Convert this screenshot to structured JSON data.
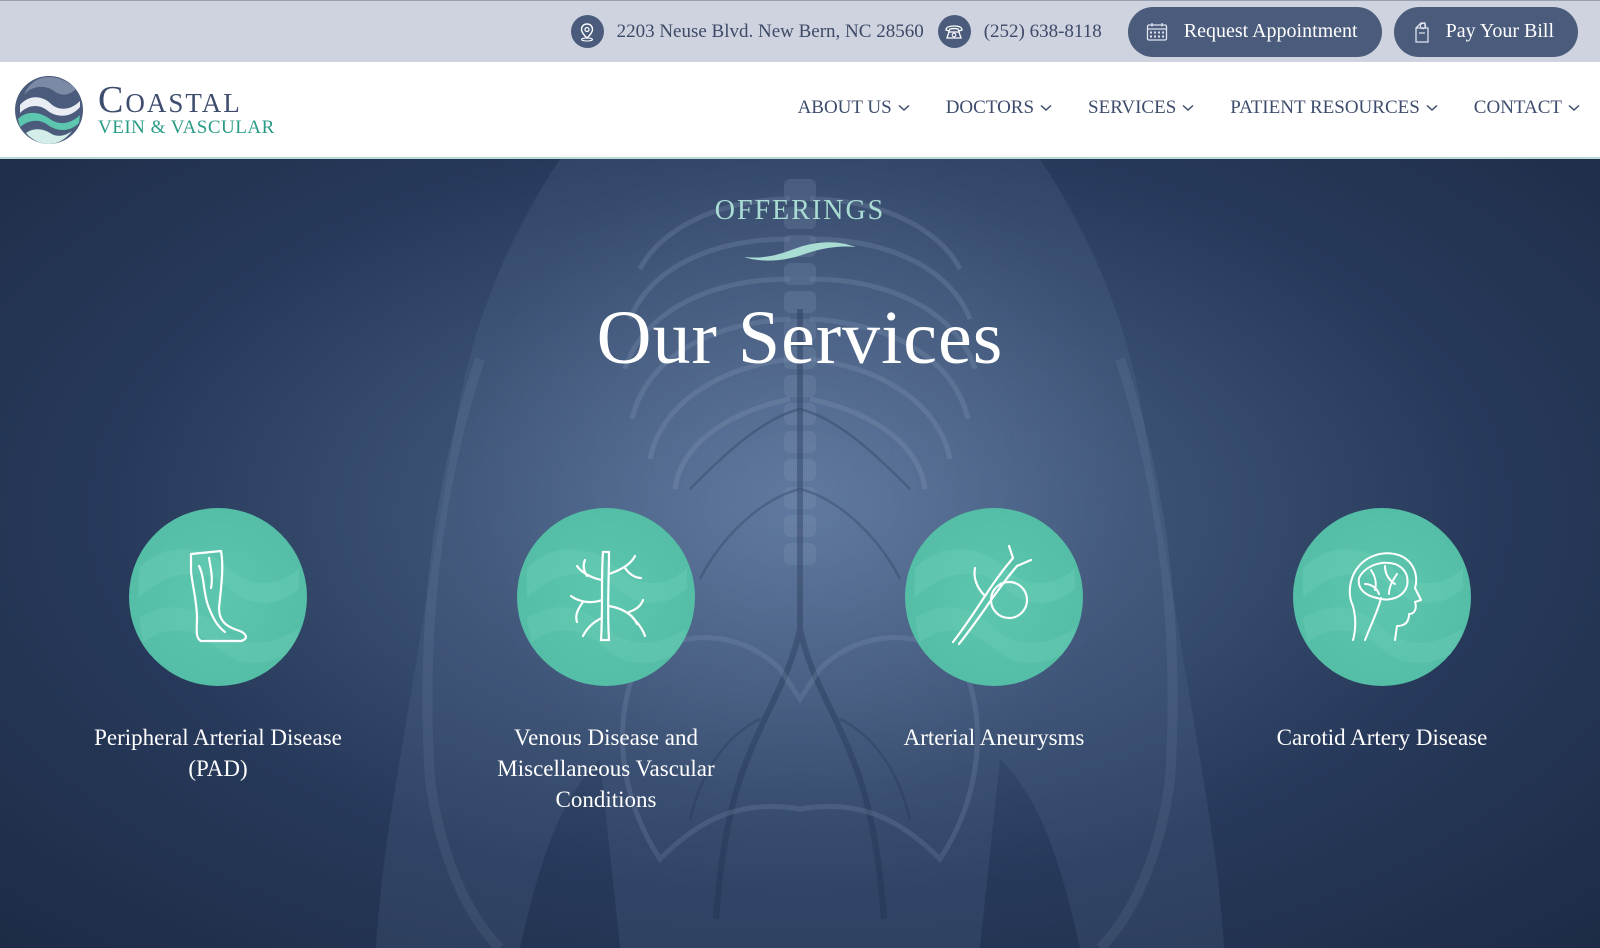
{
  "topbar": {
    "address": "2203 Neuse Blvd. New Bern, NC 28560",
    "phone": "(252) 638-8118",
    "request_button": "Request Appointment",
    "pay_button": "Pay Your Bill",
    "icons": [
      "location-pin-icon",
      "phone-icon",
      "calendar-icon",
      "wallet-icon"
    ]
  },
  "logo": {
    "line1": "Coastal",
    "line2": "Vein & Vascular"
  },
  "nav": {
    "items": [
      {
        "label": "ABOUT US"
      },
      {
        "label": "DOCTORS"
      },
      {
        "label": "SERVICES"
      },
      {
        "label": "PATIENT RESOURCES"
      },
      {
        "label": "CONTACT"
      }
    ]
  },
  "hero": {
    "eyebrow": "OFFERINGS",
    "title": "Our Services",
    "services": [
      {
        "label": "Peripheral Arterial Disease (PAD)",
        "icon": "leg-icon"
      },
      {
        "label": "Venous Disease and Miscellaneous Vascular Conditions",
        "icon": "veins-icon"
      },
      {
        "label": "Arterial Aneurysms",
        "icon": "aneurysm-icon"
      },
      {
        "label": "Carotid Artery Disease",
        "icon": "head-brain-icon"
      }
    ]
  },
  "colors": {
    "topbar_bg": "#cfd3e0",
    "navy": "#4a5b7c",
    "teal": "#5dc6ae",
    "teal_text": "#2a9c86",
    "hero_dark": "#1d2b45",
    "eyebrow": "#a9dcd3"
  }
}
